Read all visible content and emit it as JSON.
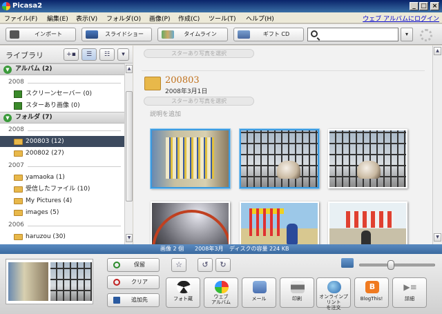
{
  "window": {
    "title": "Picasa2"
  },
  "menu": {
    "items": [
      "ファイル(F)",
      "編集(E)",
      "表示(V)",
      "フォルダ(O)",
      "画像(P)",
      "作成(C)",
      "ツール(T)",
      "ヘルプ(H)"
    ],
    "web_login": "ウェブ アルバムにログイン"
  },
  "toolbar": {
    "import": "インポート",
    "slideshow": "スライドショー",
    "timeline": "タイムライン",
    "giftcd": "ギフト CD",
    "search_value": ""
  },
  "library": {
    "title": "ライブラリ",
    "albums_section": "アルバム (2)",
    "albums_year": "2008",
    "albums": [
      "スクリーンセーバー (0)",
      "スターあり画像 (0)"
    ],
    "folders_section": "フォルダ (7)",
    "folder_groups": [
      {
        "year": "2008",
        "items": [
          "200803 (12)",
          "200802 (27)"
        ]
      },
      {
        "year": "2007",
        "items": [
          "yamaoka (1)",
          "受信したファイル (10)",
          "My Pictures (4)",
          "images (5)"
        ]
      },
      {
        "year": "2006",
        "items": [
          "haruzou (30)"
        ]
      }
    ],
    "selected": "200803 (12)"
  },
  "main": {
    "prev_star": "スターあり写真を選択",
    "folder_name": "200803",
    "folder_date": "2008年3月1日",
    "star_select": "スターあり写真を選択",
    "add_caption": "説明を追加"
  },
  "status": {
    "count": "画像 2 個",
    "date": "2008年3月",
    "disk": "ディスクの容量 224 KB"
  },
  "tray": {
    "hold": "保留",
    "clear": "クリア",
    "add_to": "追加先",
    "actions": [
      "フォト蔵",
      "ウェブ\nアルバム",
      "メール",
      "印刷",
      "オンラインプリント\nを注文",
      "BlogThis!",
      "詳細"
    ]
  },
  "colors": {
    "accent": "#3a9ae0",
    "status_bar": "#4a7ab0",
    "selected_row": "#3c4a5e",
    "folder_title": "#c0701a"
  }
}
